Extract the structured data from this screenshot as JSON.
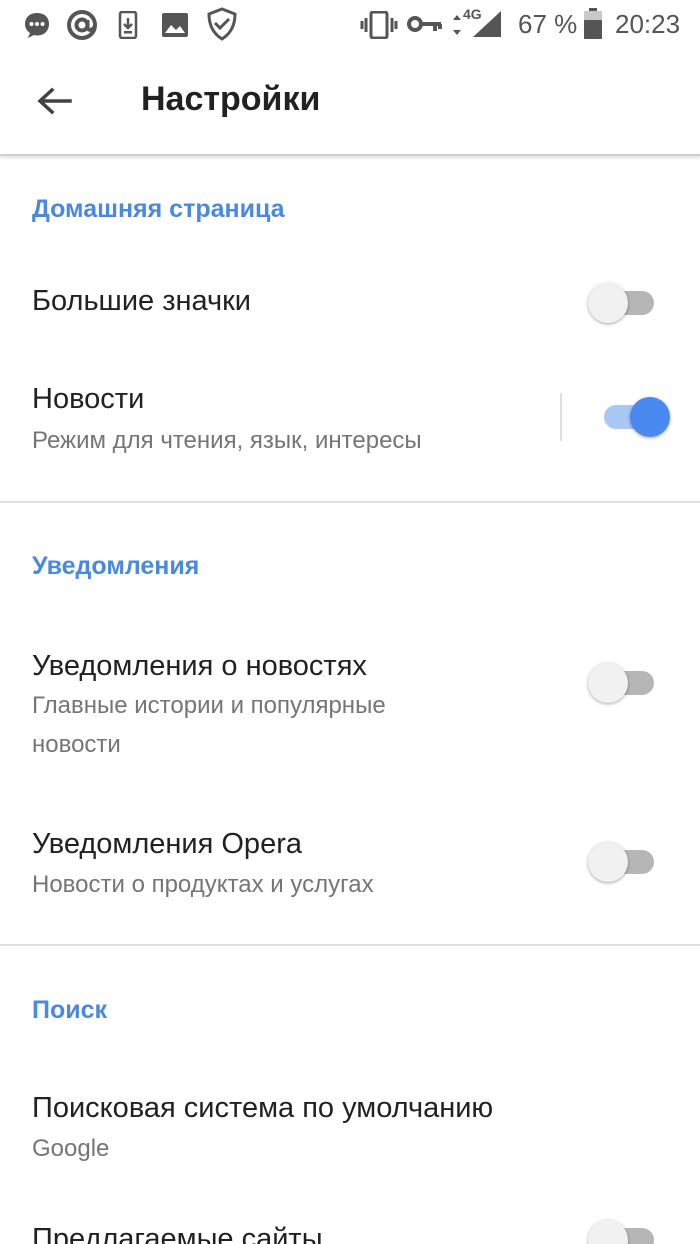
{
  "status_bar": {
    "battery": "67 %",
    "time": "20:23",
    "network": "4G",
    "icons": [
      "chat-bubble-icon",
      "at-sign-icon",
      "download-icon",
      "image-icon",
      "shield-check-icon",
      "vibrate-icon",
      "vpn-key-icon",
      "signal-icon",
      "battery-icon"
    ]
  },
  "app_bar": {
    "title": "Настройки",
    "back_icon": "arrow-back-icon"
  },
  "sections": {
    "home": {
      "header": "Домашняя страница",
      "big_icons": {
        "title": "Большие значки",
        "enabled": false
      },
      "news": {
        "title": "Новости",
        "subtitle": "Режим для чтения, язык, интересы",
        "enabled": true
      }
    },
    "notifications": {
      "header": "Уведомления",
      "news_notifications": {
        "title": "Уведомления о новостях",
        "subtitle_line1": "Главные истории и популярные",
        "subtitle_line2": "новости",
        "enabled": false
      },
      "opera_notifications": {
        "title": "Уведомления Opera",
        "subtitle": "Новости о продуктах и услугах",
        "enabled": false
      }
    },
    "search": {
      "header": "Поиск",
      "default_engine": {
        "title": "Поисковая система по умолчанию",
        "value": "Google"
      },
      "suggested_sites": {
        "title": "Предлагаемые сайты",
        "enabled": false
      }
    }
  },
  "colors": {
    "accent": "#4a89dc",
    "toggle_on": "#4a89f0",
    "toggle_on_track": "#a9c8f4",
    "toggle_off_track": "#b6b6b6"
  }
}
